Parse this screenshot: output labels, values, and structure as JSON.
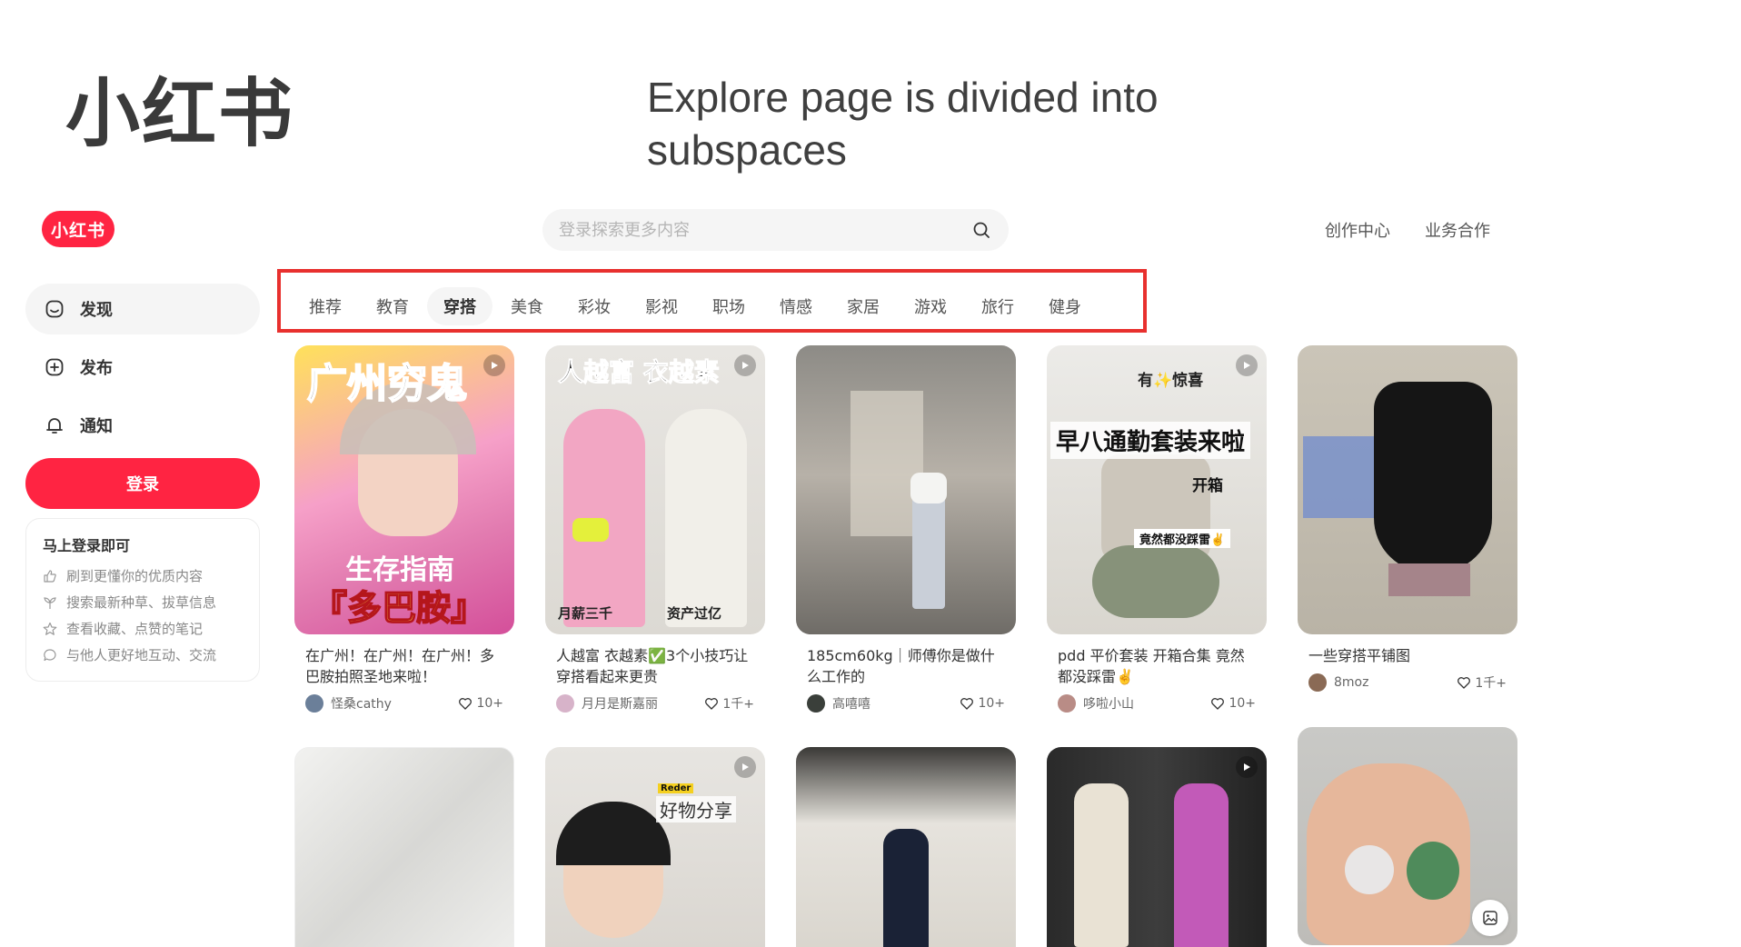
{
  "slide": {
    "title": "小红书",
    "caption": "Explore page is divided into subspaces"
  },
  "logo_text": "小红书",
  "search": {
    "placeholder": "登录探索更多内容"
  },
  "header": {
    "links": [
      "创作中心",
      "业务合作"
    ]
  },
  "sidebar": {
    "nav": [
      {
        "label": "发现",
        "icon": "discover-icon",
        "active": true
      },
      {
        "label": "发布",
        "icon": "plus-square-icon",
        "active": false
      },
      {
        "label": "通知",
        "icon": "bell-icon",
        "active": false
      }
    ],
    "login_button": "登录",
    "login_card": {
      "title": "马上登录即可",
      "items": [
        {
          "text": "刷到更懂你的优质内容",
          "icon": "thumb-up-icon"
        },
        {
          "text": "搜索最新种草、拔草信息",
          "icon": "sprout-icon"
        },
        {
          "text": "查看收藏、点赞的笔记",
          "icon": "star-icon"
        },
        {
          "text": "与他人更好地互动、交流",
          "icon": "chat-icon"
        }
      ]
    }
  },
  "channels": {
    "items": [
      "推荐",
      "教育",
      "穿搭",
      "美食",
      "彩妆",
      "影视",
      "职场",
      "情感",
      "家居",
      "游戏",
      "旅行",
      "健身"
    ],
    "active": "穿搭",
    "highlight_color": "#e8302e"
  },
  "feed": {
    "row1": [
      {
        "overlay_top": "广州穷鬼",
        "overlay_mid": "生存指南",
        "overlay_bottom": "『多巴胺』",
        "title": "在广州！在广州！在广州！多巴胺拍照圣地来啦！",
        "author": "怪桑cathy",
        "likes": "10+"
      },
      {
        "overlay_top": "人越富 衣越素",
        "overlay_left": "月薪三千",
        "overlay_right": "资产过亿",
        "title": "人越富 衣越素✅3个小技巧让穿搭看起来更贵",
        "author": "月月是斯嘉丽",
        "likes": "1千+"
      },
      {
        "title": "185cm60kg｜师傅你是做什么工作的",
        "author": "高嘻嘻",
        "likes": "10+"
      },
      {
        "overlay_top": "有✨惊喜",
        "overlay_mid": "早八通勤套装来啦",
        "overlay_sub": "开箱",
        "overlay_bottom": "竟然都没踩雷✌️",
        "title": "pdd 平价套装 开箱合集 竟然都没踩雷✌️",
        "author": "哆啦小山",
        "likes": "10+"
      },
      {
        "title": "一些穿搭平铺图",
        "author": "8moz",
        "likes": "1千+"
      }
    ],
    "row2": [
      {
        "overlay": ""
      },
      {
        "overlay_tag": "Reder",
        "overlay": "好物分享"
      },
      {
        "overlay": ""
      },
      {
        "overlay": ""
      },
      {
        "overlay": ""
      }
    ]
  },
  "colors": {
    "brand": "#ff2442",
    "highlight": "#e8302e"
  }
}
